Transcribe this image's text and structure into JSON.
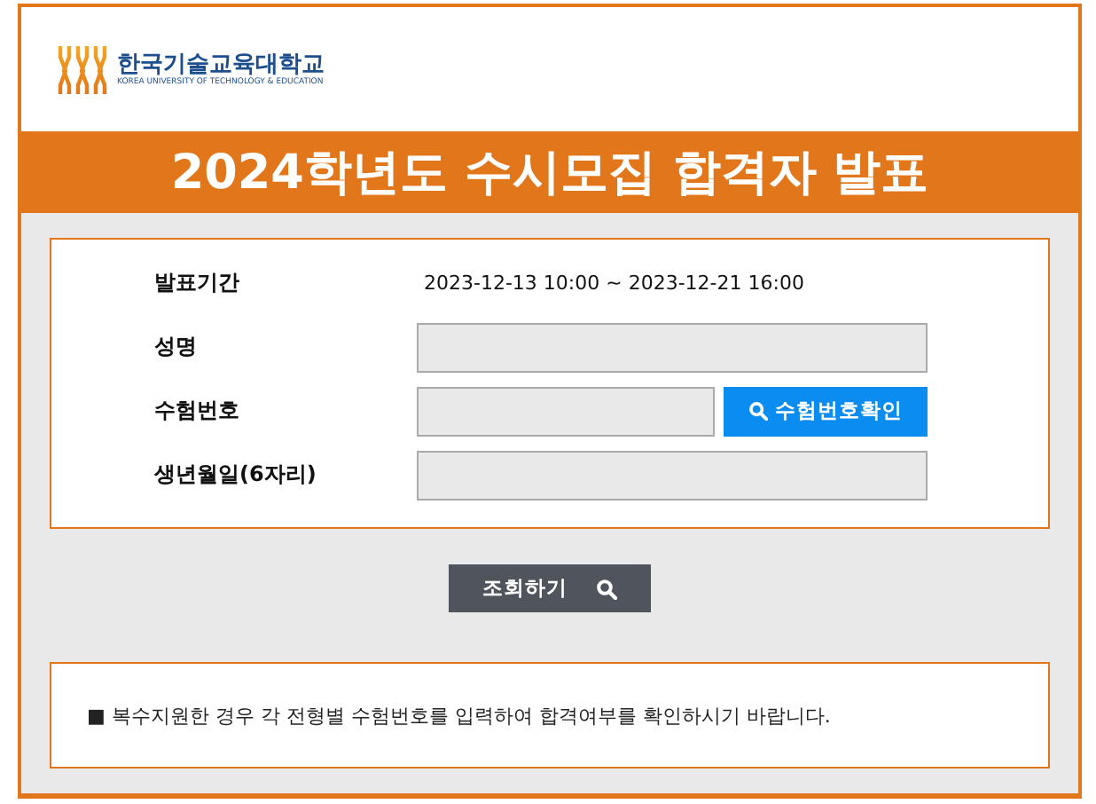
{
  "header": {
    "logo_name": "한국기술교육대학교",
    "logo_subtitle": "KOREA UNIVERSITY OF TECHNOLOGY & EDUCATION"
  },
  "banner": {
    "title": "2024학년도 수시모집 합격자 발표"
  },
  "form": {
    "rows": [
      {
        "kind": "text",
        "label": "발표기간",
        "value": "2023-12-13 10:00 ~ 2023-12-21 16:00"
      },
      {
        "kind": "input",
        "label": "성명"
      },
      {
        "kind": "input-button",
        "label": "수험번호",
        "button": "수험번호확인"
      },
      {
        "kind": "input",
        "label": "생년월일(6자리)"
      }
    ]
  },
  "submit_button": "조회하기",
  "notice": "■ 복수지원한 경우 각 전형별 수험번호를 입력하여 합격여부를 확인하시기 바랍니다."
}
